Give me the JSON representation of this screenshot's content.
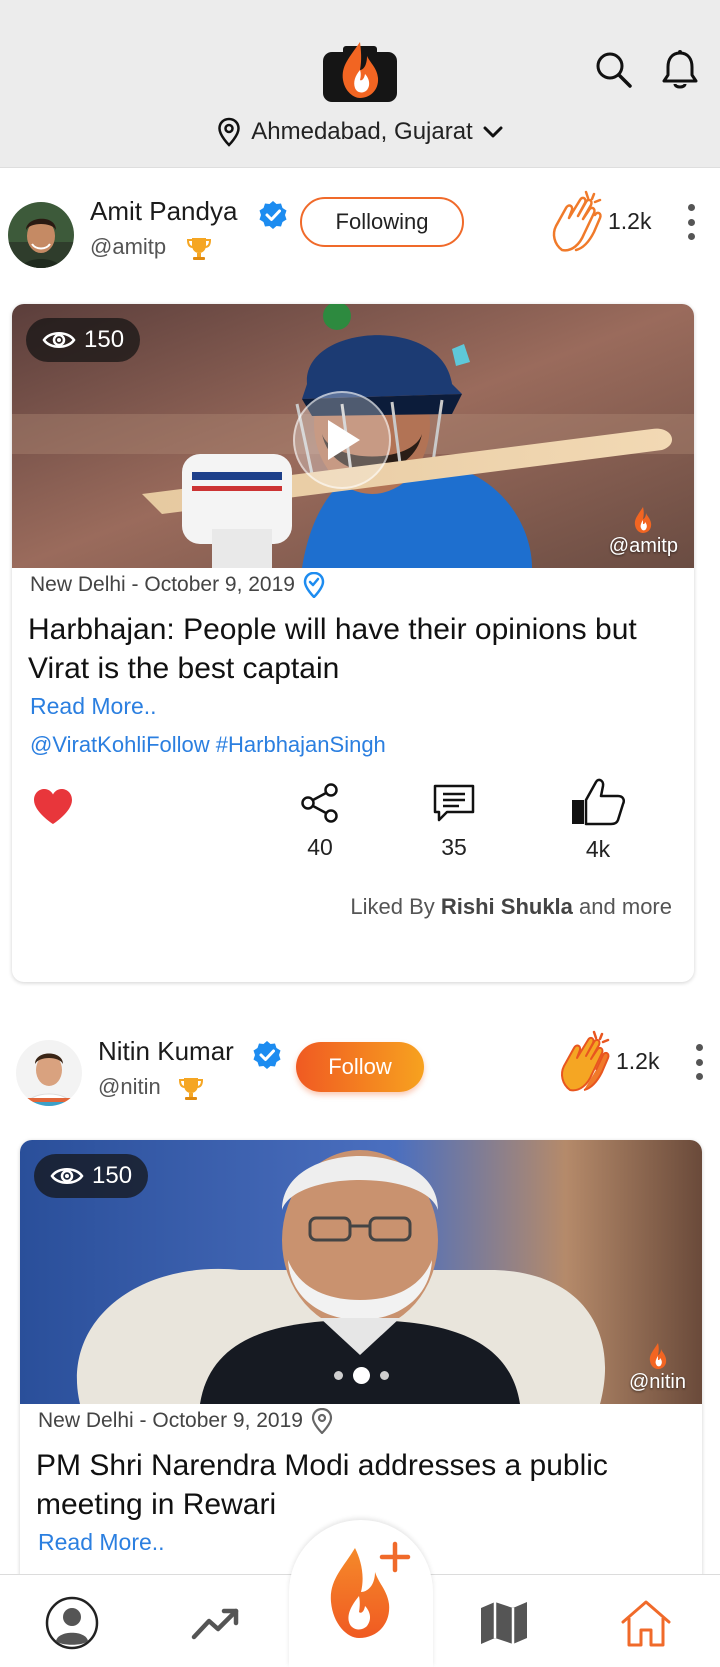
{
  "header": {
    "location": "Ahmedabad, Gujarat"
  },
  "posts": [
    {
      "author_name": "Amit Pandya",
      "handle": "@amitp",
      "follow_label": "Following",
      "claps": "1.2k",
      "views": "150",
      "watermark": "@amitp",
      "meta": "New Delhi - October 9, 2019",
      "title": "Harbhajan: People will have their opinions but Virat is the best captain",
      "read_more": "Read More..",
      "tags": "@ViratKohliFollow #HarbhajanSingh",
      "shares": "40",
      "comments": "35",
      "likes": "4k",
      "liked_by_prefix": "Liked By",
      "liked_by_name": "Rishi Shukla",
      "liked_by_suffix": "and more"
    },
    {
      "author_name": "Nitin Kumar",
      "handle": "@nitin",
      "follow_label": "Follow",
      "claps": "1.2k",
      "views": "150",
      "watermark": "@nitin",
      "meta": "New Delhi - October 9, 2019",
      "title": "PM Shri Narendra Modi addresses a public meeting in Rewari",
      "read_more": "Read More.."
    }
  ],
  "colors": {
    "accent": "#f06a2a",
    "link": "#2b7fe0",
    "verified": "#1d8cf0",
    "heart": "#e8363b"
  },
  "nav": [
    "profile-icon",
    "trending-icon",
    "create-post-icon",
    "map-icon",
    "home-icon"
  ]
}
